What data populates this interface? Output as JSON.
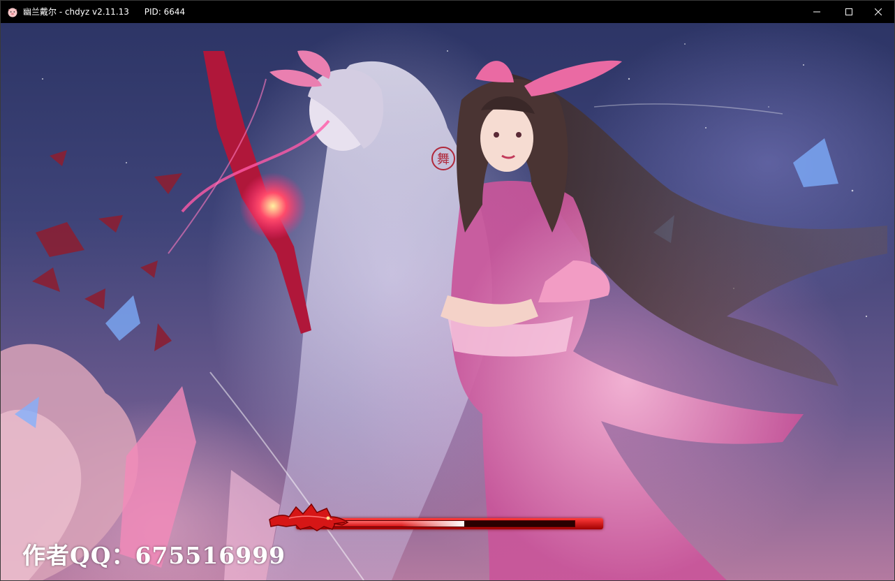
{
  "window": {
    "title": "幽兰戴尔 - chdyz v2.11.13",
    "pid_text": "PID: 6644",
    "icon": "pig-face-icon",
    "controls": [
      "minimize-icon",
      "maximize-icon",
      "close-icon"
    ]
  },
  "splash": {
    "author_qq": "作者QQ：675516999",
    "seal_char": "舞"
  },
  "loading": {
    "progress": 0.58,
    "decoration": "red-dragon-head"
  },
  "colors": {
    "titlebar_bg": "#000000",
    "bar_red": "#d21010",
    "accent_pink": "#e86aa8"
  }
}
